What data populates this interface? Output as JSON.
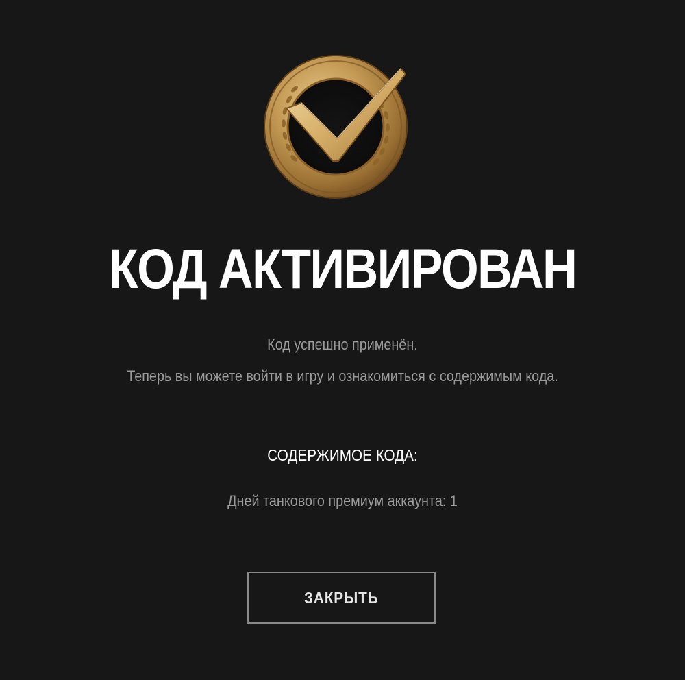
{
  "dialog": {
    "icon": "gold-checkmark-medal-icon",
    "title": "КОД АКТИВИРОВАН",
    "description_line1": "Код успешно применён.",
    "description_line2": "Теперь вы можете войти в игру и ознакомиться с содержимым кода.",
    "contents_heading": "СОДЕРЖИМОЕ КОДА:",
    "contents_items": [
      "Дней танкового премиум аккаунта: 1"
    ],
    "close_label": "ЗАКРЫТЬ"
  },
  "colors": {
    "background": "#171717",
    "title": "#ffffff",
    "secondary_text": "#9a9a9a",
    "button_border": "#8a8a8a",
    "medal_gold": "#c9a15a"
  }
}
